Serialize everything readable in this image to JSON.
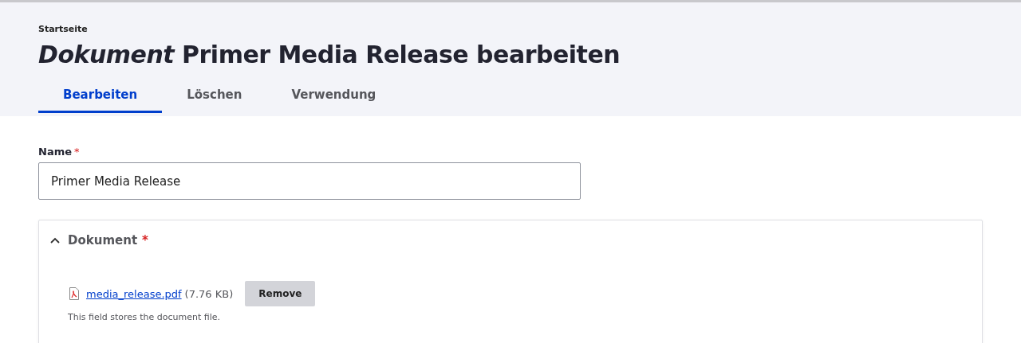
{
  "breadcrumb": "Startseite",
  "title": "*Dokument* Primer Media Release bearbeiten",
  "tabs": [
    {
      "label": "Bearbeiten",
      "selected": true
    },
    {
      "label": "Löschen",
      "selected": false
    },
    {
      "label": "Verwendung",
      "selected": false
    }
  ],
  "name_field": {
    "label": "Name",
    "required_mark": "*",
    "value": "Primer Media Release"
  },
  "document_section": {
    "title": "Dokument",
    "required_mark": "*",
    "expanded": true,
    "file": {
      "name": "media_release.pdf",
      "size": "(7.76 KB)",
      "button": "Remove"
    },
    "description": "This field stores the document file."
  }
}
